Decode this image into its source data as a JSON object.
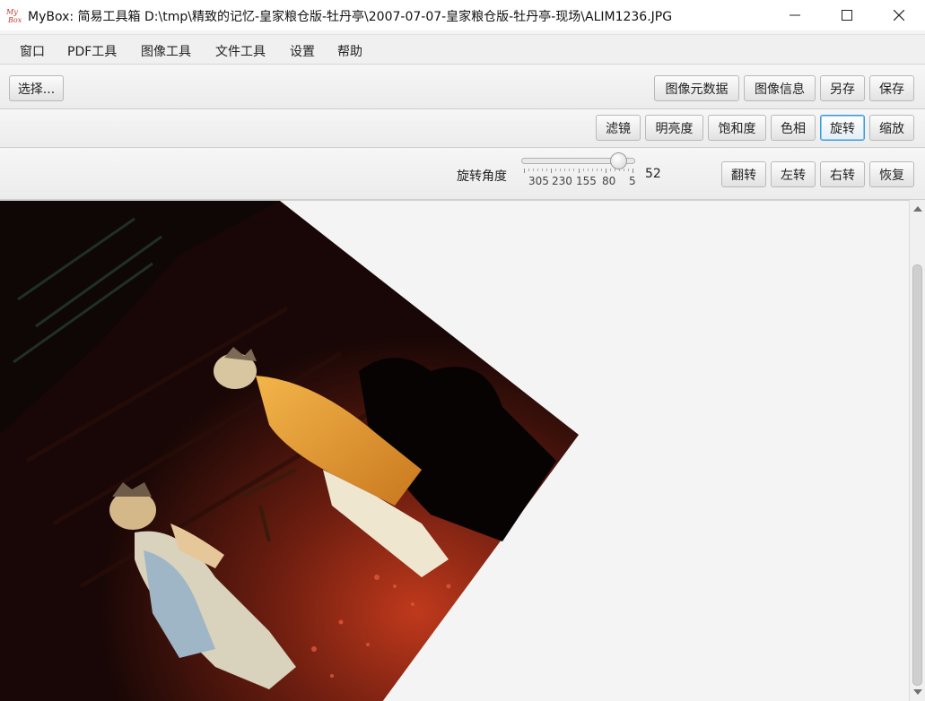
{
  "window": {
    "title": "MyBox:  简易工具箱  D:\\tmp\\精致的记忆-皇家粮仓版-牡丹亭\\2007-07-07-皇家粮仓版-牡丹亭-现场\\ALIM1236.JPG",
    "logo_text": "My Box",
    "controls": [
      "minimize-icon",
      "maximize-icon",
      "close-icon"
    ]
  },
  "menu": {
    "items": [
      "窗口",
      "PDF工具",
      "图像工具",
      "文件工具",
      "设置",
      "帮助"
    ]
  },
  "toolbar_top": {
    "select_label": "选择...",
    "metadata_label": "图像元数据",
    "info_label": "图像信息",
    "save_as_label": "另存",
    "save_label": "保存"
  },
  "toolbar_tools": {
    "items": [
      "滤镜",
      "明亮度",
      "饱和度",
      "色相",
      "旋转",
      "缩放"
    ],
    "active": "旋转"
  },
  "rotate_panel": {
    "slider_label": "旋转角度",
    "slider_value": "52",
    "tick_labels": [
      "305",
      "230",
      "155",
      "80",
      "5"
    ],
    "flip_label": "翻转",
    "rotate_left_label": "左转",
    "rotate_right_label": "右转",
    "restore_label": "恢复"
  },
  "image": {
    "rotation_degrees": 52,
    "background_color": "#f4f4f4"
  },
  "colors": {
    "accent_border": "#3a9ad9",
    "logo_red": "#c0392b"
  }
}
